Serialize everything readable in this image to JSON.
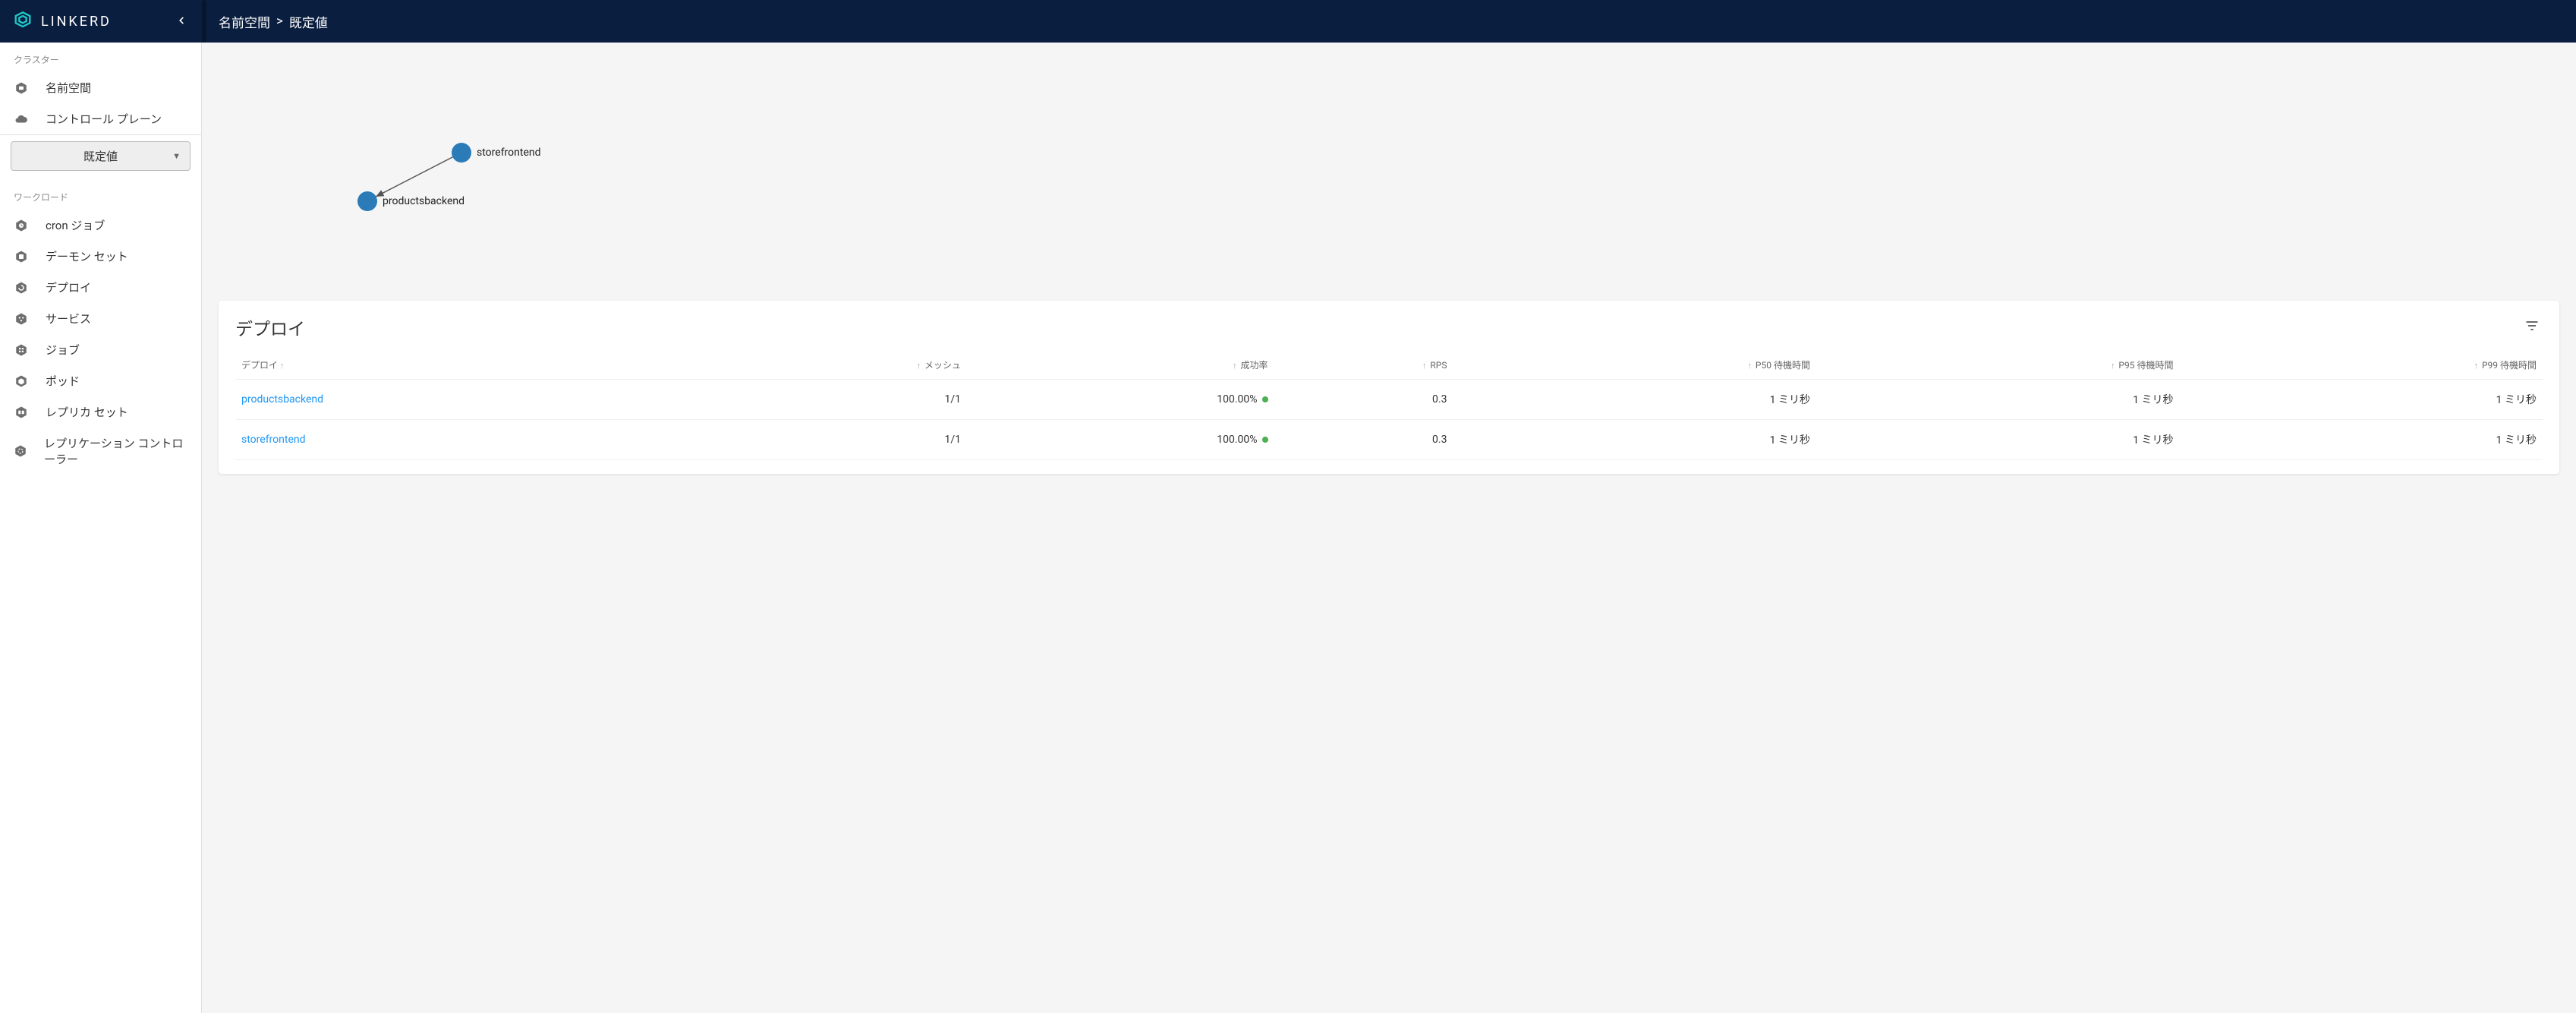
{
  "brand": "LINKERD",
  "breadcrumb": {
    "part1": "名前空間",
    "sep": ">",
    "part2": "既定値"
  },
  "sidebar": {
    "section_cluster_label": "クラスター",
    "section_workload_label": "ワークロード",
    "cluster_items": [
      {
        "label": "名前空間"
      },
      {
        "label": "コントロール プレーン"
      }
    ],
    "ns_select": {
      "value": "既定値"
    },
    "workload_items": [
      {
        "label": "cron ジョブ"
      },
      {
        "label": "デーモン セット"
      },
      {
        "label": "デプロイ"
      },
      {
        "label": "サービス"
      },
      {
        "label": "ジョブ"
      },
      {
        "label": "ポッド"
      },
      {
        "label": "レプリカ セット"
      },
      {
        "label": "レプリケーション コントローラー"
      }
    ]
  },
  "graph": {
    "nodes": [
      {
        "id": "storefrontend",
        "label": "storefrontend"
      },
      {
        "id": "productsbackend",
        "label": "productsbackend"
      }
    ]
  },
  "table": {
    "title": "デプロイ",
    "columns": [
      {
        "label": "デプロイ"
      },
      {
        "label": "メッシュ"
      },
      {
        "label": "成功率"
      },
      {
        "label": "RPS"
      },
      {
        "label": "P50 待機時間"
      },
      {
        "label": "P95 待機時間"
      },
      {
        "label": "P99 待機時間"
      }
    ],
    "rows": [
      {
        "name": "productsbackend",
        "mesh": "1/1",
        "success": "100.00%",
        "rps": "0.3",
        "p50": "1 ミリ秒",
        "p95": "1 ミリ秒",
        "p99": "1 ミリ秒"
      },
      {
        "name": "storefrontend",
        "mesh": "1/1",
        "success": "100.00%",
        "rps": "0.3",
        "p50": "1 ミリ秒",
        "p95": "1 ミリ秒",
        "p99": "1 ミリ秒"
      }
    ]
  }
}
